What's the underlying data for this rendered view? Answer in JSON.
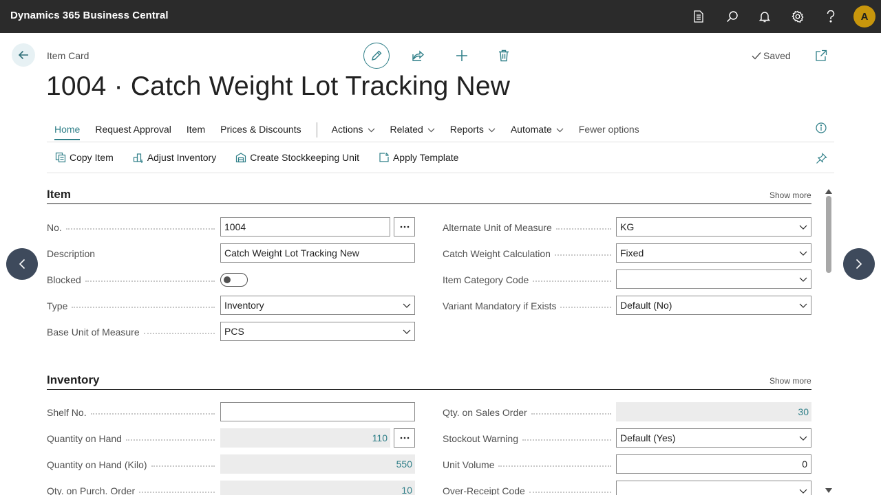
{
  "app": {
    "title": "Dynamics 365 Business Central",
    "user_initial": "A"
  },
  "header": {
    "breadcrumb": "Item Card",
    "saved_label": "Saved",
    "page_title": "1004 · Catch Weight Lot Tracking New"
  },
  "tabs": {
    "home": "Home",
    "request_approval": "Request Approval",
    "item": "Item",
    "prices_discounts": "Prices & Discounts",
    "actions": "Actions",
    "related": "Related",
    "reports": "Reports",
    "automate": "Automate",
    "fewer_options": "Fewer options"
  },
  "actions": {
    "copy_item": "Copy Item",
    "adjust_inventory": "Adjust Inventory",
    "create_sku": "Create Stockkeeping Unit",
    "apply_template": "Apply Template"
  },
  "item_section": {
    "title": "Item",
    "show_more": "Show more",
    "no_label": "No.",
    "no_value": "1004",
    "description_label": "Description",
    "description_value": "Catch Weight Lot Tracking New",
    "blocked_label": "Blocked",
    "blocked_value": false,
    "type_label": "Type",
    "type_value": "Inventory",
    "base_uom_label": "Base Unit of Measure",
    "base_uom_value": "PCS",
    "alt_uom_label": "Alternate Unit of Measure",
    "alt_uom_value": "KG",
    "cw_calc_label": "Catch Weight Calculation",
    "cw_calc_value": "Fixed",
    "item_category_label": "Item Category Code",
    "item_category_value": "",
    "variant_mandatory_label": "Variant Mandatory if Exists",
    "variant_mandatory_value": "Default (No)"
  },
  "inventory_section": {
    "title": "Inventory",
    "show_more": "Show more",
    "shelf_no_label": "Shelf No.",
    "shelf_no_value": "",
    "qty_on_hand_label": "Quantity on Hand",
    "qty_on_hand_value": "110",
    "qty_on_hand_kilo_label": "Quantity on Hand (Kilo)",
    "qty_on_hand_kilo_value": "550",
    "qty_purch_order_label": "Qty. on Purch. Order",
    "qty_purch_order_value": "10",
    "qty_sales_order_label": "Qty. on Sales Order",
    "qty_sales_order_value": "30",
    "stockout_warning_label": "Stockout Warning",
    "stockout_warning_value": "Default (Yes)",
    "unit_volume_label": "Unit Volume",
    "unit_volume_value": "0",
    "over_receipt_label": "Over-Receipt Code",
    "over_receipt_value": ""
  },
  "colors": {
    "accent": "#2f7f88",
    "appbar": "#2b2b2b",
    "avatar": "#c8960c",
    "nav_circle": "#3e4a5c"
  }
}
